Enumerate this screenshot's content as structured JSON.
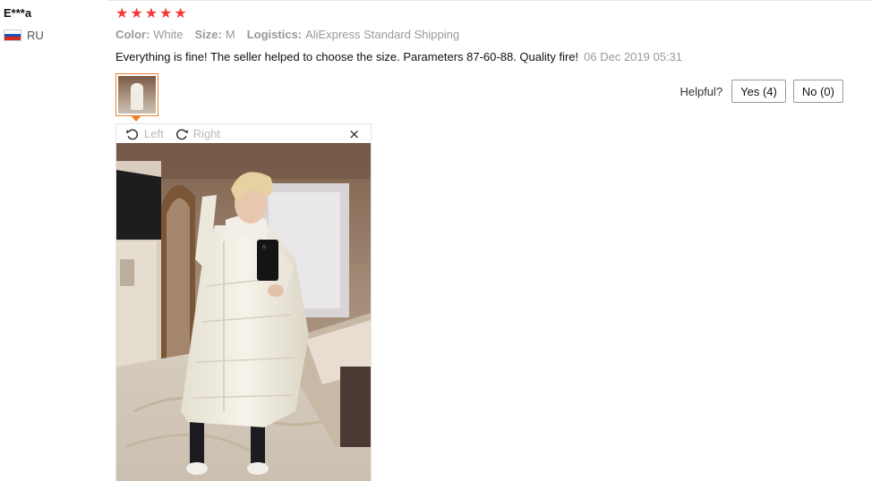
{
  "review": {
    "user": "E***a",
    "country": "RU",
    "rating": 5,
    "attributes": [
      {
        "label": "Color:",
        "value": "White"
      },
      {
        "label": "Size:",
        "value": "M"
      },
      {
        "label": "Logistics:",
        "value": "AliExpress Standard Shipping"
      }
    ],
    "text": "Everything is fine! The seller helped to choose the size. Parameters 87-60-88. Quality fire!",
    "date": "06 Dec 2019 05:31"
  },
  "helpful": {
    "label": "Helpful?",
    "yes": "Yes (4)",
    "no": "No (0)"
  },
  "viewer": {
    "rotate_left": "Left",
    "rotate_right": "Right",
    "close": "×"
  },
  "colors": {
    "star": "#f23a3a",
    "accent": "#f0802a"
  }
}
